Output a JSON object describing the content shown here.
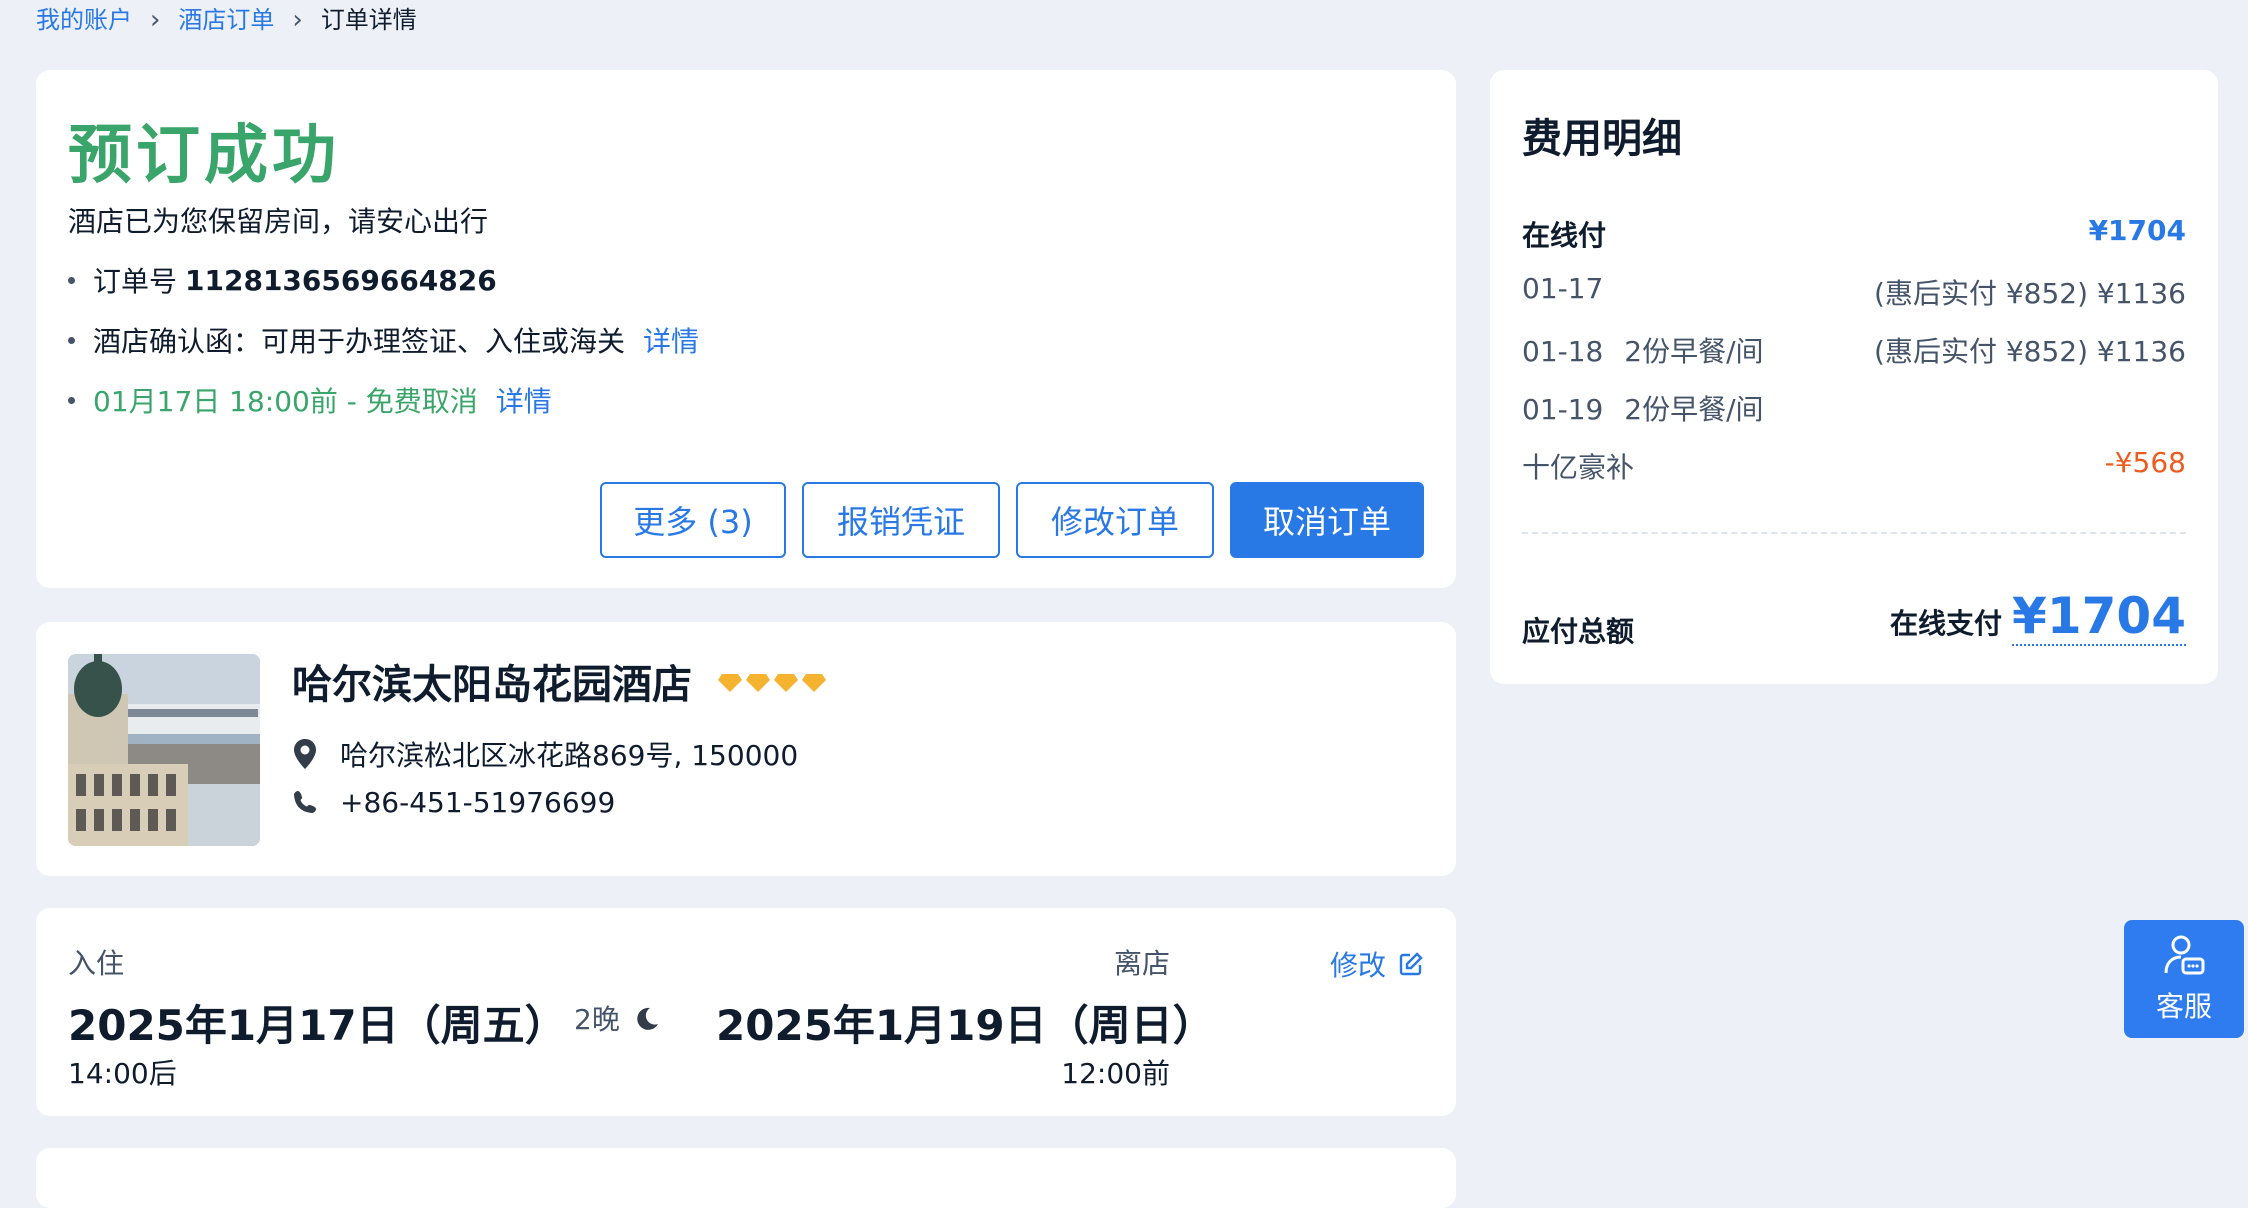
{
  "breadcrumb": {
    "items": [
      "我的账户",
      "酒店订单"
    ],
    "current": "订单详情"
  },
  "status": {
    "title": "预订成功",
    "subtitle": "酒店已为您保留房间，请安心出行",
    "order_label": "订单号",
    "order_number": "1128136569664826",
    "confirm_text": "酒店确认函：可用于办理签证、入住或海关",
    "confirm_link": "详情",
    "cancel_policy": "01月17日 18:00前 - 免费取消",
    "cancel_link": "详情",
    "buttons": {
      "more": "更多 (3)",
      "receipt": "报销凭证",
      "modify": "修改订单",
      "cancel": "取消订单"
    }
  },
  "hotel": {
    "name": "哈尔滨太阳岛花园酒店",
    "diamond_rating": 4,
    "address": "哈尔滨松北区冰花路869号, 150000",
    "phone": "+86-451-51976699"
  },
  "stay": {
    "checkin_label": "入住",
    "checkin_date": "2025年1月17日（周五）",
    "checkin_time": "14:00后",
    "nights": "2晚",
    "checkout_label": "离店",
    "checkout_date": "2025年1月19日（周日）",
    "checkout_time": "12:00前",
    "modify": "修改"
  },
  "costs": {
    "title": "费用明细",
    "online_pay_label": "在线付",
    "online_pay_amount": "¥1704",
    "rows": [
      {
        "date": "01-17",
        "desc": "",
        "price": "(惠后实付 ¥852) ¥1136"
      },
      {
        "date": "01-18",
        "desc": "2份早餐/间",
        "price": "(惠后实付 ¥852) ¥1136"
      },
      {
        "date": "01-19",
        "desc": "2份早餐/间",
        "price": ""
      }
    ],
    "subsidy_label": "十亿豪补",
    "subsidy_amount": "-¥568",
    "total_label": "应付总额",
    "total_method": "在线支付",
    "total_amount": "¥1704"
  },
  "service": {
    "label": "客服"
  },
  "colors": {
    "accent": "#2878e6",
    "success": "#3aa56a",
    "discount": "#ef5a1e",
    "background": "#edf1f7"
  }
}
